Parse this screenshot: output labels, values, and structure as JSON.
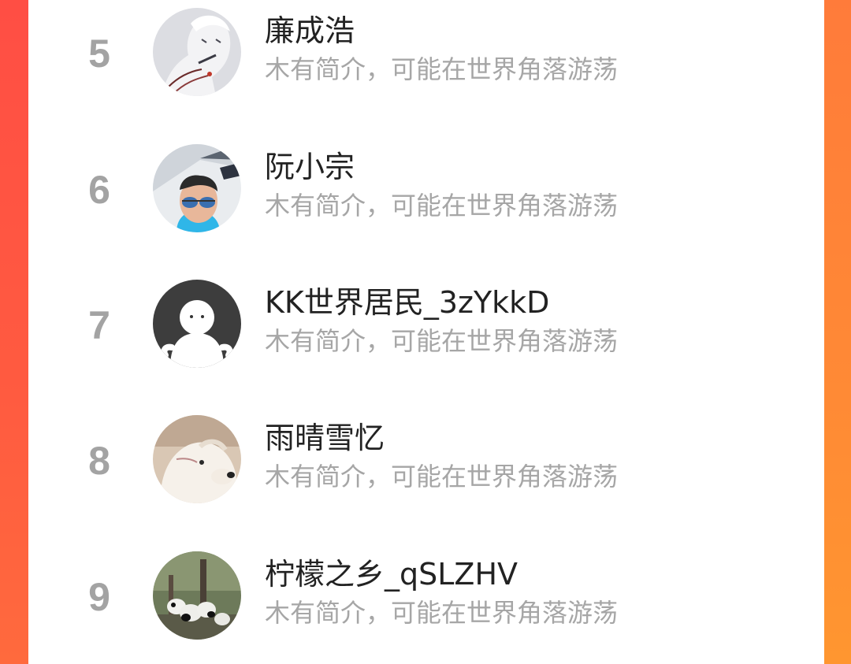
{
  "theme": {
    "background_accent": "#ff5a40",
    "panel": "#ffffff",
    "rank_color": "#a3a3a3",
    "name_color": "#222222",
    "bio_color": "#a6a6a6"
  },
  "ranking": {
    "rows": [
      {
        "rank": "5",
        "name": "廉成浩",
        "bio": "木有简介，可能在世界角落游荡",
        "avatar": "anime-character-avatar"
      },
      {
        "rank": "6",
        "name": "阮小宗",
        "bio": "木有简介，可能在世界角落游荡",
        "avatar": "man-sunglasses-avatar"
      },
      {
        "rank": "7",
        "name": "KK世界居民_3zYkkD",
        "bio": "木有简介，可能在世界角落游荡",
        "avatar": "default-user-avatar"
      },
      {
        "rank": "8",
        "name": "雨晴雪忆",
        "bio": "木有简介，可能在世界角落游荡",
        "avatar": "white-dog-avatar"
      },
      {
        "rank": "9",
        "name": "柠檬之乡_qSLZHV",
        "bio": "木有简介，可能在世界角落游荡",
        "avatar": "pandas-avatar"
      }
    ]
  }
}
